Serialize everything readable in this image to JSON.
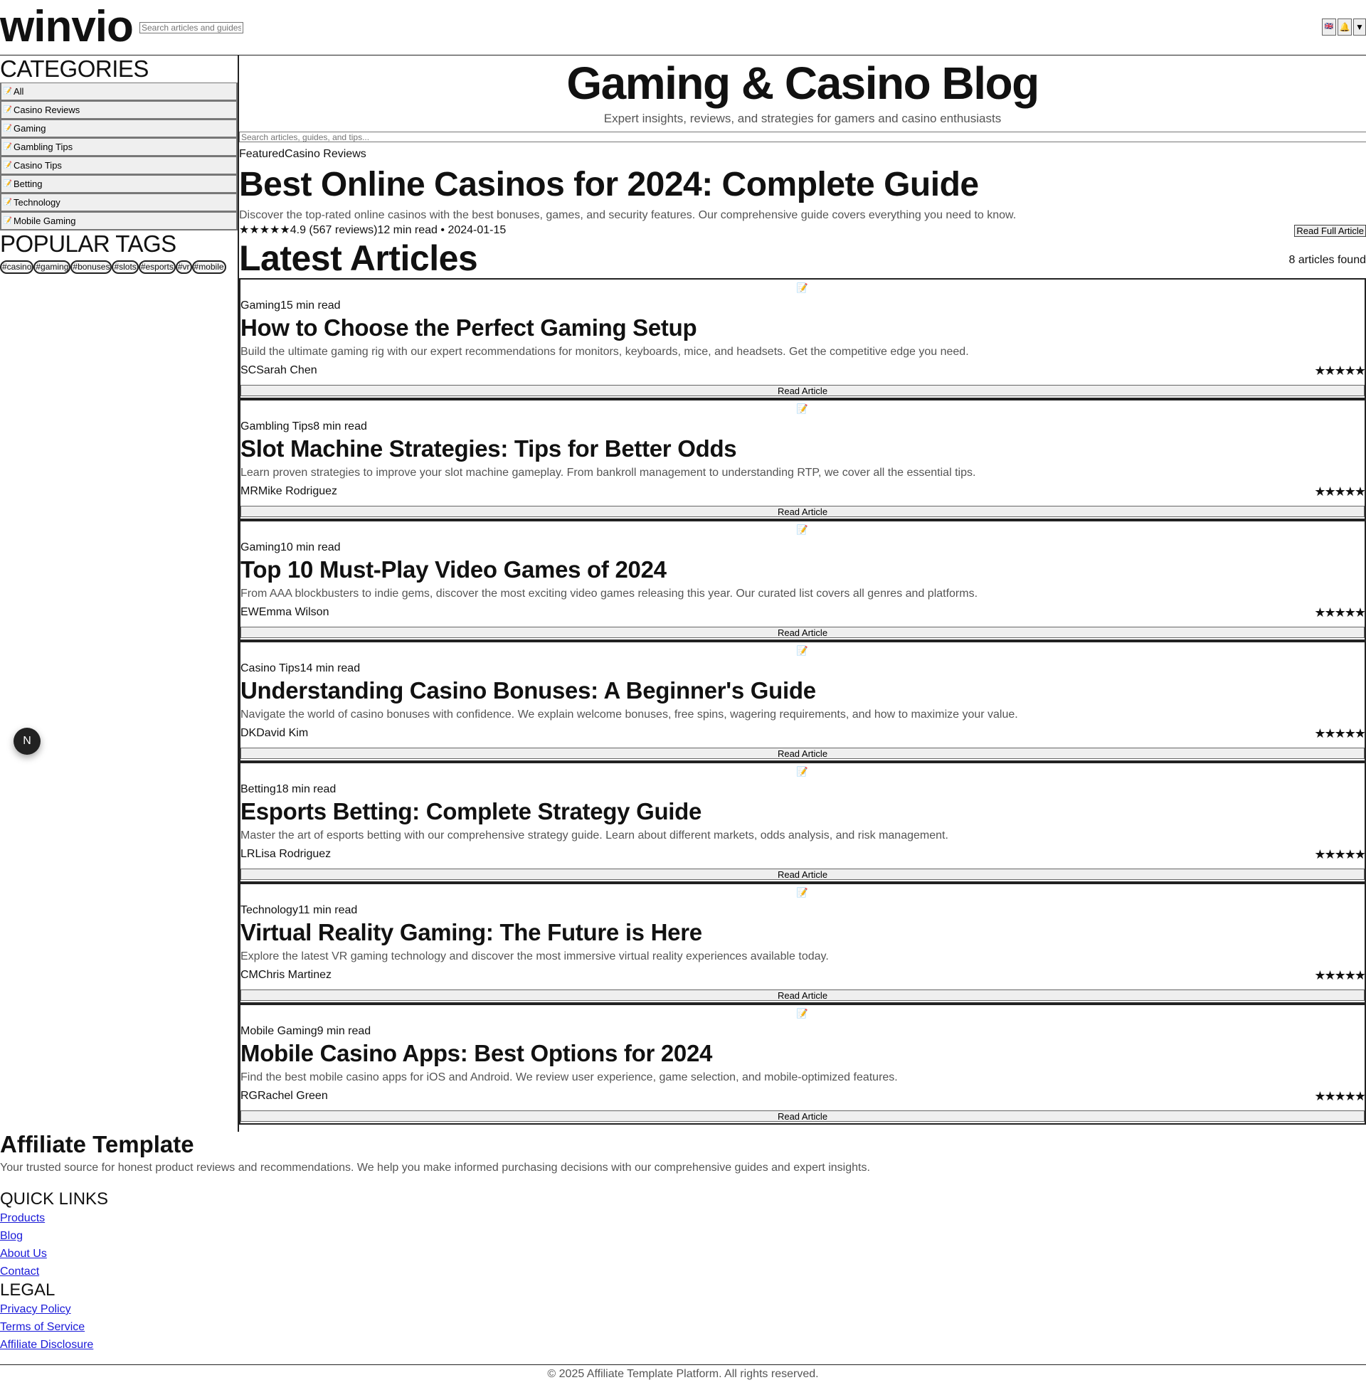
{
  "header": {
    "logo": "winvio",
    "search_placeholder": "Search articles and guides...",
    "lang_flag": "🇬🇧",
    "bell_icon": "🔔",
    "dropdown_icon": "▼"
  },
  "sidebar": {
    "categories_heading": "CATEGORIES",
    "category_icon": "📝",
    "categories": [
      "All",
      "Casino Reviews",
      "Gaming",
      "Gambling Tips",
      "Casino Tips",
      "Betting",
      "Technology",
      "Mobile Gaming"
    ],
    "tags_heading": "POPULAR TAGS",
    "tags": [
      "#casino",
      "#gaming",
      "#bonuses",
      "#slots",
      "#esports",
      "#vr",
      "#mobile"
    ],
    "floating_avatar": "N"
  },
  "main": {
    "title": "Gaming & Casino Blog",
    "subtitle": "Expert insights, reviews, and strategies for gamers and casino enthusiasts",
    "search_placeholder": "Search articles, guides, and tips...",
    "featured": {
      "badge": "Featured",
      "category": "Casino Reviews",
      "title": "Best Online Casinos for 2024: Complete Guide",
      "description": "Discover the top-rated online casinos with the best bonuses, games, and security features. Our comprehensive guide covers everything you need to know.",
      "stars": "★★★★★",
      "rating": "4.9 (567 reviews)",
      "read_time": "12 min read",
      "separator": " • ",
      "date": "2024-01-15",
      "button": "Read Full Article"
    },
    "latest_heading": "Latest Articles",
    "count_text": "8 articles found",
    "article_icon": "📝",
    "article_button": "Read Article",
    "articles": [
      {
        "category": "Gaming",
        "read_time": "15 min read",
        "title": "How to Choose the Perfect Gaming Setup",
        "description": "Build the ultimate gaming rig with our expert recommendations for monitors, keyboards, mice, and headsets. Get the competitive edge you need.",
        "initials": "SC",
        "author": "Sarah Chen",
        "stars": "★★★★★"
      },
      {
        "category": "Gambling Tips",
        "read_time": "8 min read",
        "title": "Slot Machine Strategies: Tips for Better Odds",
        "description": "Learn proven strategies to improve your slot machine gameplay. From bankroll management to understanding RTP, we cover all the essential tips.",
        "initials": "MR",
        "author": "Mike Rodriguez",
        "stars": "★★★★★"
      },
      {
        "category": "Gaming",
        "read_time": "10 min read",
        "title": "Top 10 Must-Play Video Games of 2024",
        "description": "From AAA blockbusters to indie gems, discover the most exciting video games releasing this year. Our curated list covers all genres and platforms.",
        "initials": "EW",
        "author": "Emma Wilson",
        "stars": "★★★★★"
      },
      {
        "category": "Casino Tips",
        "read_time": "14 min read",
        "title": "Understanding Casino Bonuses: A Beginner's Guide",
        "description": "Navigate the world of casino bonuses with confidence. We explain welcome bonuses, free spins, wagering requirements, and how to maximize your value.",
        "initials": "DK",
        "author": "David Kim",
        "stars": "★★★★★"
      },
      {
        "category": "Betting",
        "read_time": "18 min read",
        "title": "Esports Betting: Complete Strategy Guide",
        "description": "Master the art of esports betting with our comprehensive strategy guide. Learn about different markets, odds analysis, and risk management.",
        "initials": "LR",
        "author": "Lisa Rodriguez",
        "stars": "★★★★★"
      },
      {
        "category": "Technology",
        "read_time": "11 min read",
        "title": "Virtual Reality Gaming: The Future is Here",
        "description": "Explore the latest VR gaming technology and discover the most immersive virtual reality experiences available today.",
        "initials": "CM",
        "author": "Chris Martinez",
        "stars": "★★★★★"
      },
      {
        "category": "Mobile Gaming",
        "read_time": "9 min read",
        "title": "Mobile Casino Apps: Best Options for 2024",
        "description": "Find the best mobile casino apps for iOS and Android. We review user experience, game selection, and mobile-optimized features.",
        "initials": "RG",
        "author": "Rachel Green",
        "stars": "★★★★★"
      }
    ]
  },
  "footer": {
    "brand": "Affiliate Template",
    "description": "Your trusted source for honest product reviews and recommendations. We help you make informed purchasing decisions with our comprehensive guides and expert insights.",
    "quick_links_heading": "QUICK LINKS",
    "quick_links": [
      "Products",
      "Blog",
      "About Us",
      "Contact"
    ],
    "legal_heading": "LEGAL",
    "legal_links": [
      "Privacy Policy",
      "Terms of Service",
      "Affiliate Disclosure"
    ],
    "copyright": "© 2025 Affiliate Template Platform. All rights reserved."
  },
  "colors": {
    "link": "#1a1ad8",
    "muted_text": "#555555",
    "border": "#222222",
    "button_bg": "#efefef"
  }
}
